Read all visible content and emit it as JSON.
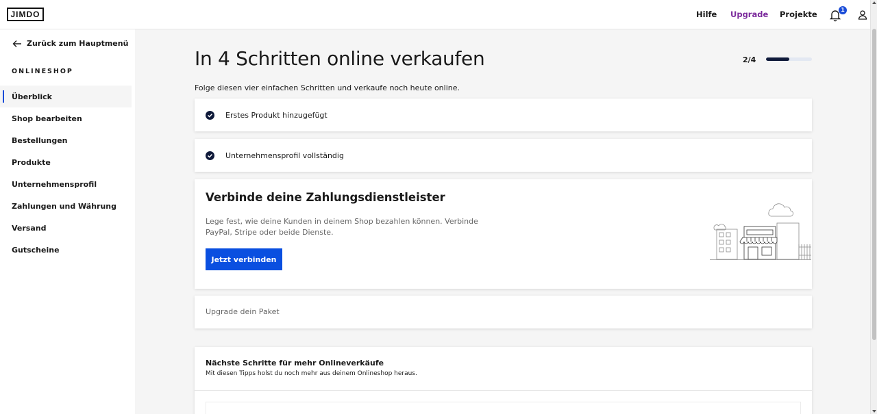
{
  "header": {
    "logo": "JIMDO",
    "nav": {
      "hilfe": "Hilfe",
      "upgrade": "Upgrade",
      "projekte": "Projekte"
    },
    "notifications_count": "1",
    "icons": [
      "bell-icon",
      "user-icon"
    ]
  },
  "sidebar": {
    "back_label": "Zurück zum Hauptmenü",
    "section_title": "ONLINESHOP",
    "items": [
      {
        "label": "Überblick",
        "active": true
      },
      {
        "label": "Shop bearbeiten"
      },
      {
        "label": "Bestellungen"
      },
      {
        "label": "Produkte"
      },
      {
        "label": "Unternehmensprofil"
      },
      {
        "label": "Zahlungen und Währung"
      },
      {
        "label": "Versand"
      },
      {
        "label": "Gutscheine"
      }
    ]
  },
  "main": {
    "title": "In 4 Schritten online verkaufen",
    "step_indicator": "2/4",
    "progress_fraction": 0.5,
    "subtitle": "Folge diesen vier einfachen Schritten und verkaufe noch heute online.",
    "steps": [
      {
        "label": "Erstes Produkt hinzugefügt",
        "done": true
      },
      {
        "label": "Unternehmensprofil vollständig",
        "done": true
      }
    ],
    "current_step": {
      "title": "Verbinde deine Zahlungsdienstleister",
      "description": "Lege fest, wie deine Kunden in deinem Shop bezahlen können. Verbinde PayPal, Stripe oder beide Dienste.",
      "button_label": "Jetzt verbinden"
    },
    "upcoming_step": {
      "label": "Upgrade dein Paket"
    },
    "next_steps": {
      "title": "Nächste Schritte für mehr Onlineverkäufe",
      "description": "Mit diesen Tipps holst du noch mehr aus deinem Onlineshop heraus."
    }
  },
  "colors": {
    "accent_blue": "#0a4fe0",
    "upgrade_purple": "#7b2a9c",
    "progress_dark": "#0f1a3a",
    "progress_track": "#e3e8f2"
  }
}
